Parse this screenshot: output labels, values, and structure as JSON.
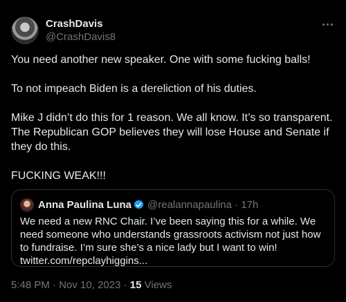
{
  "author": {
    "name": "CrashDavis",
    "handle": "@CrashDavis8"
  },
  "tweet": {
    "paragraphs": [
      "You need another new speaker. One with some fucking balls!",
      "To not impeach Biden is a dereliction of his duties.",
      "Mike J didn’t do this for 1 reason. We all know. It’s so transparent. The Republican GOP believes they will lose House and Senate if they do this.",
      "FUCKING WEAK!!!"
    ]
  },
  "quote": {
    "name": "Anna Paulina Luna",
    "handle_time": "@realannapaulina · 17h",
    "text": "We need a new RNC Chair. I’ve been saying this for a while. We need someone who understands grassroots activism not just how to fundraise. I’m sure she’s a nice lady but I want to win! twitter.com/repclayhiggins...",
    "verified_color": "#1d9bf0"
  },
  "meta": {
    "timestamp": "5:48 PM · Nov 10, 2023",
    "separator": "·",
    "views_count": "15",
    "views_label": "Views"
  },
  "icons": [
    "more-icon",
    "verified-icon"
  ]
}
